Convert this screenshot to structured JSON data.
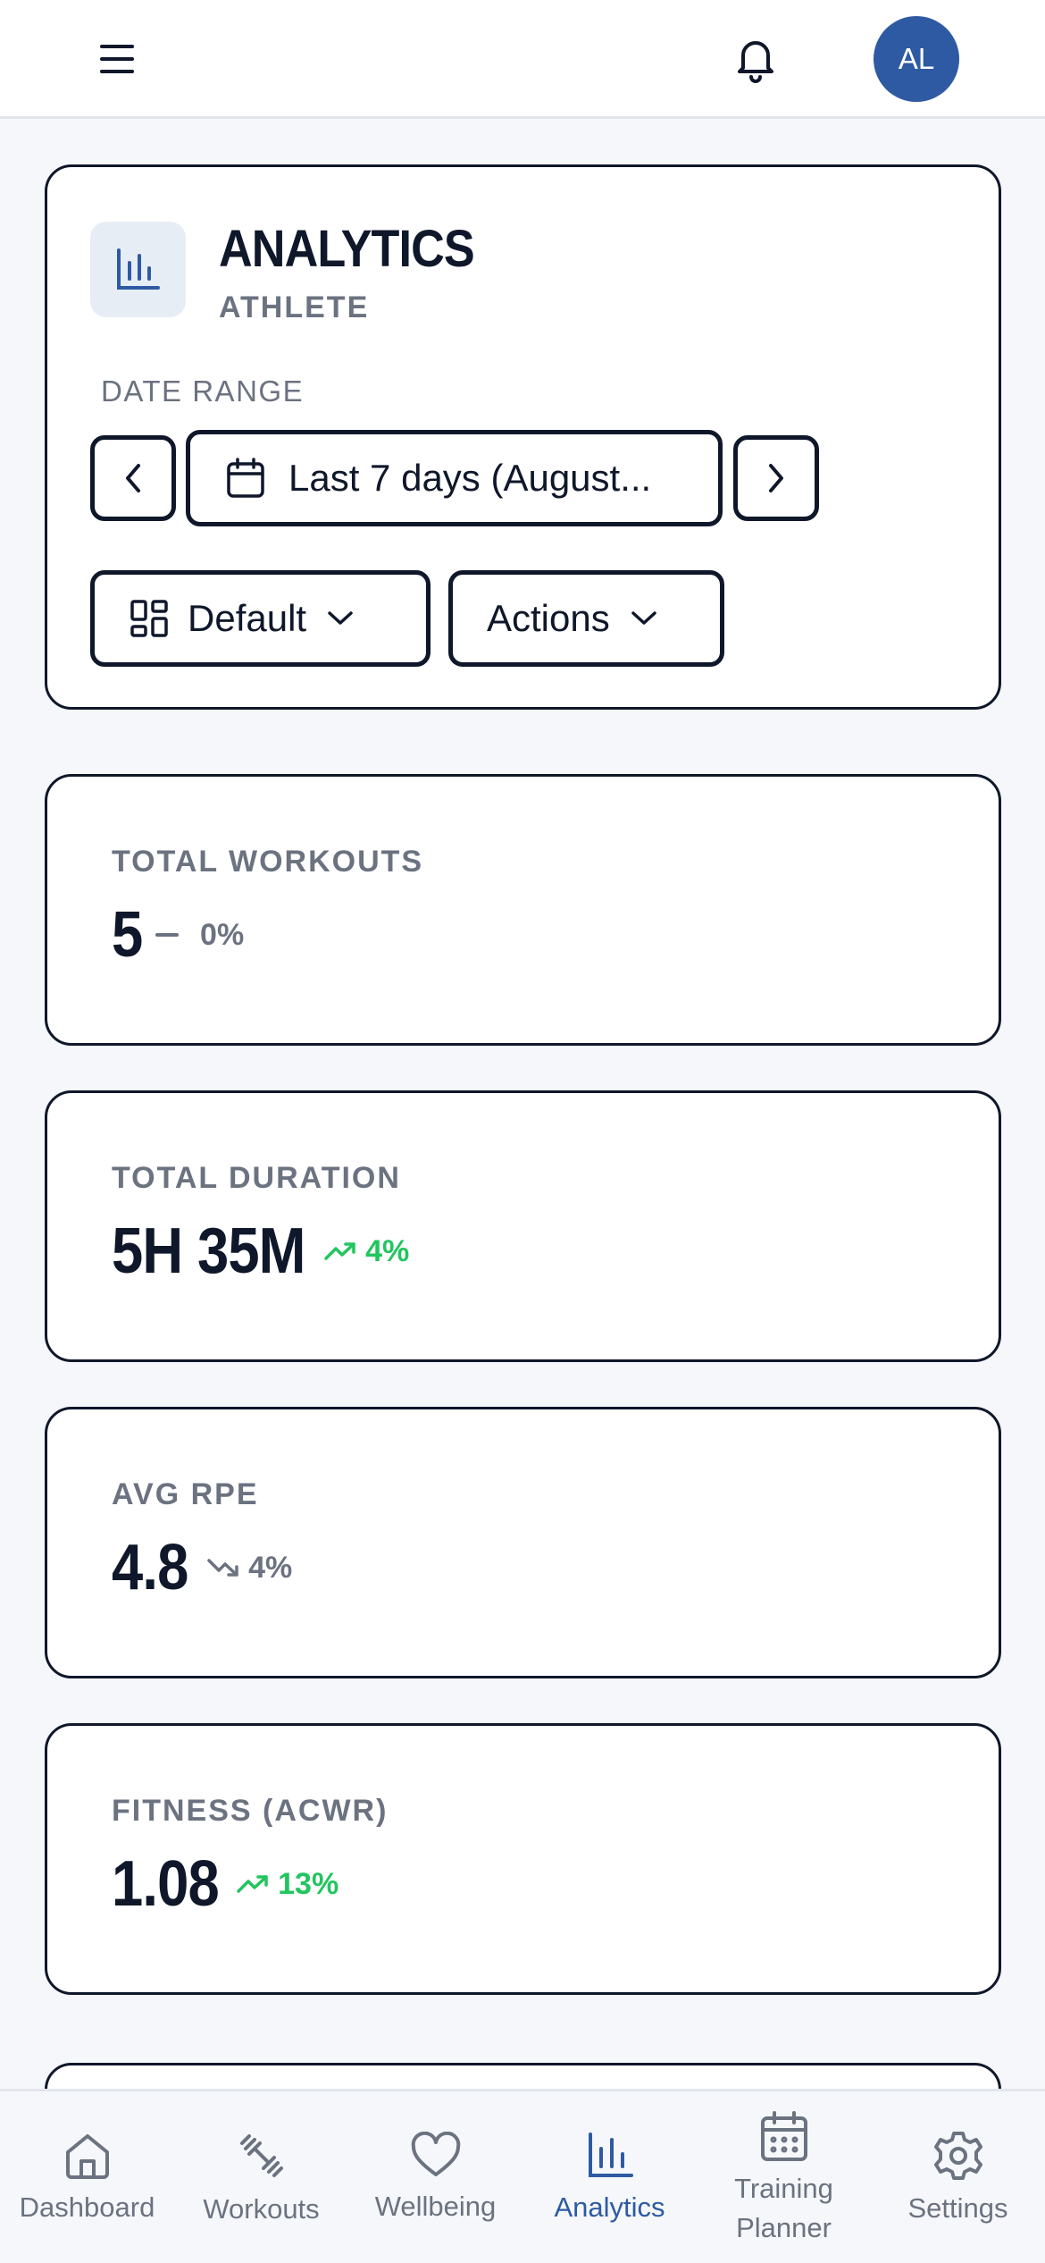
{
  "topbar": {
    "avatar_initials": "AL"
  },
  "header": {
    "title": "ANALYTICS",
    "subtitle": "ATHLETE",
    "date_range_label": "DATE RANGE",
    "date_range_value": "Last 7 days (August...",
    "layout_select": "Default",
    "actions_label": "Actions"
  },
  "stats": [
    {
      "label": "TOTAL WORKOUTS",
      "value": "5",
      "change": "0%",
      "trend": "neutral"
    },
    {
      "label": "TOTAL DURATION",
      "value": "5H 35M",
      "change": "4%",
      "trend": "up"
    },
    {
      "label": "AVG RPE",
      "value": "4.8",
      "change": "4%",
      "trend": "down"
    },
    {
      "label": "FITNESS (ACWR)",
      "value": "1.08",
      "change": "13%",
      "trend": "up"
    }
  ],
  "nav": {
    "items": [
      {
        "label": "Dashboard",
        "icon": "home-icon"
      },
      {
        "label": "Workouts",
        "icon": "dumbbell-icon"
      },
      {
        "label": "Wellbeing",
        "icon": "heart-icon"
      },
      {
        "label": "Analytics",
        "icon": "bar-chart-icon",
        "active": true
      },
      {
        "label": "Training Planner",
        "icon": "calendar-icon"
      },
      {
        "label": "Settings",
        "icon": "gear-icon"
      }
    ]
  },
  "colors": {
    "accent": "#2e5aa3",
    "positive": "#22c55e",
    "muted": "#6b7280",
    "border": "#0f172a"
  }
}
